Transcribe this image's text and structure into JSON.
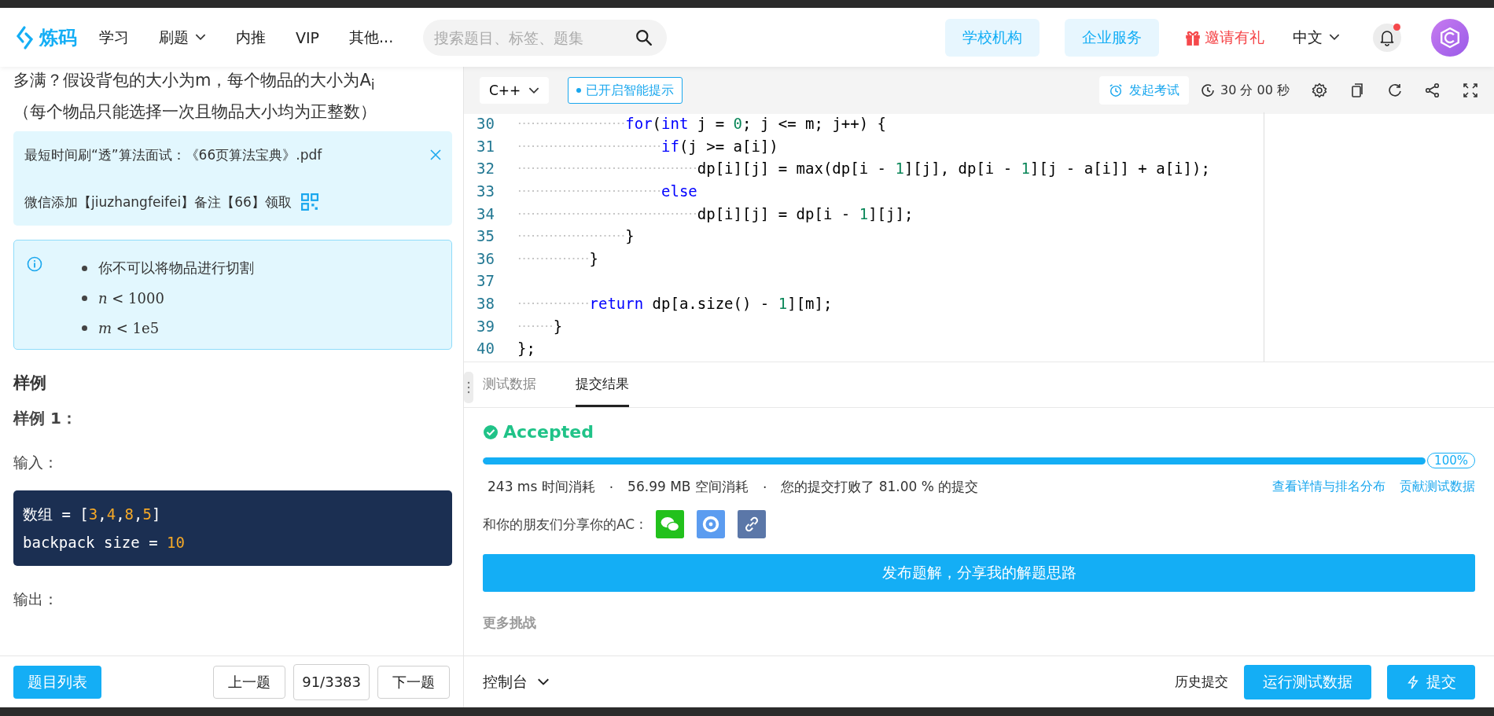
{
  "header": {
    "logo": "炼码",
    "nav": [
      {
        "label": "学习",
        "dropdown": false
      },
      {
        "label": "刷题",
        "dropdown": true
      },
      {
        "label": "内推",
        "dropdown": false
      },
      {
        "label": "VIP",
        "dropdown": false
      },
      {
        "label": "其他...",
        "dropdown": false
      }
    ],
    "search": {
      "placeholder": "搜索题目、标签、题集"
    },
    "actions": [
      {
        "label": "学校机构",
        "kind": "tinted"
      },
      {
        "label": "企业服务",
        "kind": "tinted"
      },
      {
        "label": "邀请有礼",
        "kind": "gift"
      }
    ],
    "language": "中文",
    "notification_unread": true
  },
  "problem": {
    "lines": [
      "多满？假设背包的大小为m，每个物品的大小为A$_{i}$",
      "（每个物品只能选择一次且物品大小均为正整数）"
    ],
    "promo": {
      "lines": [
        "最短时间刷“透”算法面试：《66页算法宝典》.pdf",
        "微信添加【jiuzhangfeifei】备注【66】领取"
      ]
    },
    "notes": [
      {
        "kind": "text",
        "text": "你不可以将物品进行切割"
      },
      {
        "kind": "math",
        "text": "*n* < 1000"
      },
      {
        "kind": "math",
        "text": "*m* < 1e5"
      }
    ],
    "sample_heading": "样例",
    "example_title": "样例 1：",
    "input_label": "输入：",
    "input_code": [
      [
        {
          "kind": "plain",
          "text": "数组 = ["
        },
        {
          "kind": "number",
          "text": "3"
        },
        {
          "kind": "plain",
          "text": ","
        },
        {
          "kind": "number",
          "text": "4"
        },
        {
          "kind": "plain",
          "text": ","
        },
        {
          "kind": "number",
          "text": "8"
        },
        {
          "kind": "plain",
          "text": ","
        },
        {
          "kind": "number",
          "text": "5"
        },
        {
          "kind": "plain",
          "text": "]"
        }
      ],
      [
        {
          "kind": "plain",
          "text": "backpack size = "
        },
        {
          "kind": "number",
          "text": "10"
        }
      ]
    ],
    "output_label": "输出："
  },
  "problem_footer": {
    "list_button": "题目列表",
    "prev": "上一题",
    "counter": "91/3383",
    "next": "下一题"
  },
  "editor": {
    "language": "C++",
    "hint": "已开启智能提示",
    "exam": "发起考试",
    "timer": "30 分 00 秒",
    "lines": [
      {
        "number": "30",
        "tokens": [
          {
            "kind": "keyword",
            "text": "            for"
          },
          {
            "kind": "plain",
            "text": "("
          },
          {
            "kind": "keyword",
            "text": "int"
          },
          {
            "kind": "plain",
            "text": " j = "
          },
          {
            "kind": "number",
            "text": "0"
          },
          {
            "kind": "plain",
            "text": "; j <= m; j++) {"
          }
        ]
      },
      {
        "number": "31",
        "tokens": [
          {
            "kind": "keyword",
            "text": "                if"
          },
          {
            "kind": "plain",
            "text": "(j >= a[i])"
          }
        ]
      },
      {
        "number": "32",
        "tokens": [
          {
            "kind": "plain",
            "text": "                    dp[i][j] = max(dp[i - "
          },
          {
            "kind": "number",
            "text": "1"
          },
          {
            "kind": "plain",
            "text": "][j], dp[i - "
          },
          {
            "kind": "number",
            "text": "1"
          },
          {
            "kind": "plain",
            "text": "][j - a[i]] + a[i]);"
          }
        ]
      },
      {
        "number": "33",
        "tokens": [
          {
            "kind": "keyword",
            "text": "                else"
          }
        ]
      },
      {
        "number": "34",
        "tokens": [
          {
            "kind": "plain",
            "text": "                    dp[i][j] = dp[i - "
          },
          {
            "kind": "number",
            "text": "1"
          },
          {
            "kind": "plain",
            "text": "][j];"
          }
        ]
      },
      {
        "number": "35",
        "tokens": [
          {
            "kind": "plain",
            "text": "            }"
          }
        ]
      },
      {
        "number": "36",
        "tokens": [
          {
            "kind": "plain",
            "text": "        }"
          }
        ]
      },
      {
        "number": "37"
      },
      {
        "number": "38",
        "tokens": [
          {
            "kind": "keyword",
            "text": "        return"
          },
          {
            "kind": "plain",
            "text": " dp[a.size() - "
          },
          {
            "kind": "number",
            "text": "1"
          },
          {
            "kind": "plain",
            "text": "][m];"
          }
        ]
      },
      {
        "number": "39",
        "tokens": [
          {
            "kind": "plain",
            "text": "    }"
          }
        ]
      },
      {
        "number": "40",
        "tokens": [
          {
            "kind": "plain",
            "text": "};"
          }
        ]
      }
    ]
  },
  "results": {
    "tabs": [
      {
        "label": "测试数据",
        "selected": false
      },
      {
        "label": "提交结果",
        "selected": true
      }
    ],
    "status": "Accepted",
    "level": 1,
    "percent": "100%",
    "stats": [
      "243 ms 时间消耗",
      "·",
      "56.99 MB 空间消耗",
      "·",
      "您的提交打败了 81.00 % 的提交"
    ],
    "links": [
      "查看详情与排名分布",
      "贡献测试数据"
    ],
    "share_label": "和你的朋友们分享你的AC :",
    "share": [
      {
        "kind": "wechat"
      },
      {
        "kind": "shutter"
      },
      {
        "kind": "link"
      }
    ],
    "publish": "发布题解，分享我的解题思路",
    "more": "更多挑战"
  },
  "console": {
    "label": "控制台",
    "history": "历史提交",
    "run": "运行测试数据",
    "submit": "提交"
  }
}
